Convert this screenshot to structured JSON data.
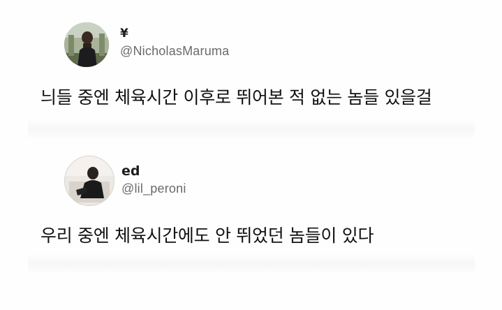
{
  "tweets": [
    {
      "display_name": "¥",
      "handle": "@NicholasMaruma",
      "text": "늬들 중엔 체육시간 이후로 뛰어본 적 없는 놈들 있을걸"
    },
    {
      "display_name": "ed",
      "handle": "@lil_peroni",
      "text": "우리 중엔 체육시간에도 안 뛰었던 놈들이 있다"
    }
  ],
  "colors": {
    "background": "#fefefe",
    "text": "#111111",
    "handle": "#6a6a6a"
  }
}
